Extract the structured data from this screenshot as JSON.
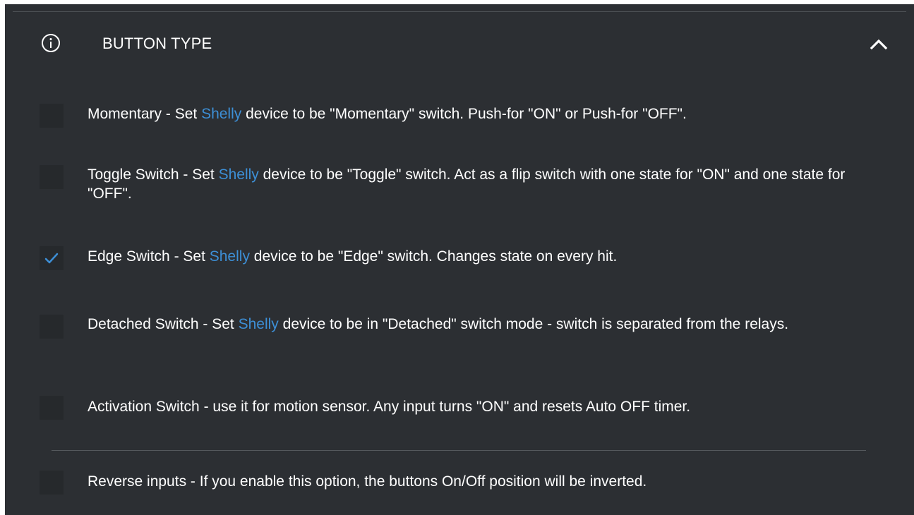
{
  "section": {
    "title": "BUTTON TYPE",
    "info_icon": "info-circle-icon",
    "collapse_icon": "chevron-up-icon"
  },
  "brand_word": "Shelly",
  "colors": {
    "panel_bg": "#2c2f33",
    "checkbox_bg": "#26292c",
    "accent": "#3d8fd6",
    "text": "#ffffff"
  },
  "options": [
    {
      "checked": false,
      "lead": "Momentary - Set ",
      "brand": "Shelly",
      "rest": " device to be \"Momentary\" switch. Push-for \"ON\" or Push-for \"OFF\"."
    },
    {
      "checked": false,
      "lead": "Toggle Switch - Set ",
      "brand": "Shelly",
      "rest": " device to be \"Toggle\" switch. Act as a flip switch with one state for \"ON\" and one state for \"OFF\"."
    },
    {
      "checked": true,
      "lead": "Edge Switch - Set ",
      "brand": "Shelly",
      "rest": " device to be \"Edge\" switch. Changes state on every hit."
    },
    {
      "checked": false,
      "lead": "Detached Switch - Set ",
      "brand": "Shelly",
      "rest": " device to be in \"Detached\" switch mode - switch is separated from the relays."
    },
    {
      "checked": false,
      "text": "Activation Switch - use it for motion sensor. Any input turns \"ON\" and resets Auto OFF timer."
    }
  ],
  "reverse_inputs": {
    "checked": false,
    "text": "Reverse inputs - If you enable this option, the buttons On/Off position will be inverted."
  }
}
